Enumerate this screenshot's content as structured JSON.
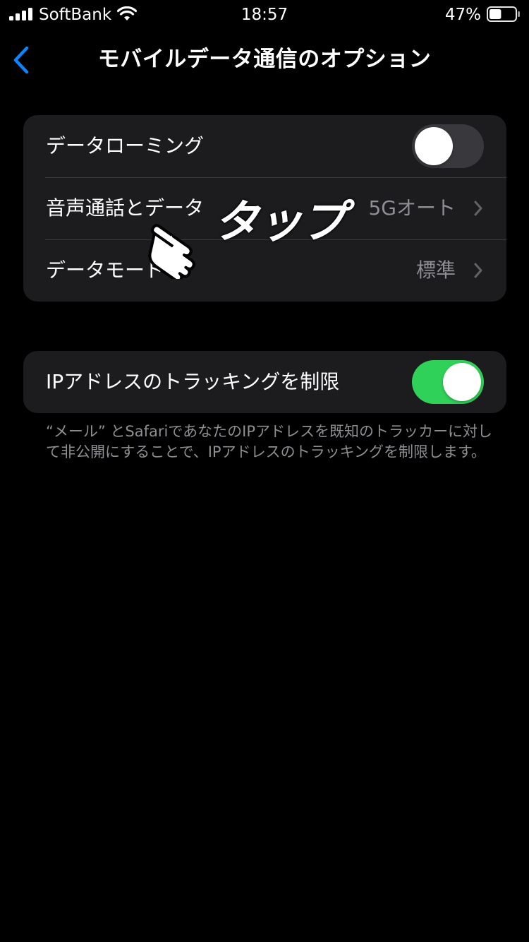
{
  "status_bar": {
    "carrier": "SoftBank",
    "time": "18:57",
    "battery_percent": "47%",
    "battery_level": 0.47
  },
  "nav": {
    "title": "モバイルデータ通信のオプション",
    "back_icon": "chevron-left-icon"
  },
  "group1": {
    "rows": [
      {
        "label": "データローミング",
        "toggle": "off"
      },
      {
        "label": "音声通話とデータ",
        "value": "5Gオート"
      },
      {
        "label": "データモード",
        "value": "標準"
      }
    ]
  },
  "group2": {
    "rows": [
      {
        "label": "IPアドレスのトラッキングを制限",
        "toggle": "on"
      }
    ],
    "footnote": "“メール” とSafariであなたのIPアドレスを既知のトラッカーに対して非公開にすることで、IPアドレスのトラッキングを制限します。"
  },
  "annotation": {
    "text": "タップ",
    "icon": "pointing-hand-icon"
  },
  "colors": {
    "background": "#000000",
    "card": "#1c1c1e",
    "accent": "#0a84ff",
    "toggle_on": "#30d158",
    "secondary_text": "#8e8e93"
  }
}
